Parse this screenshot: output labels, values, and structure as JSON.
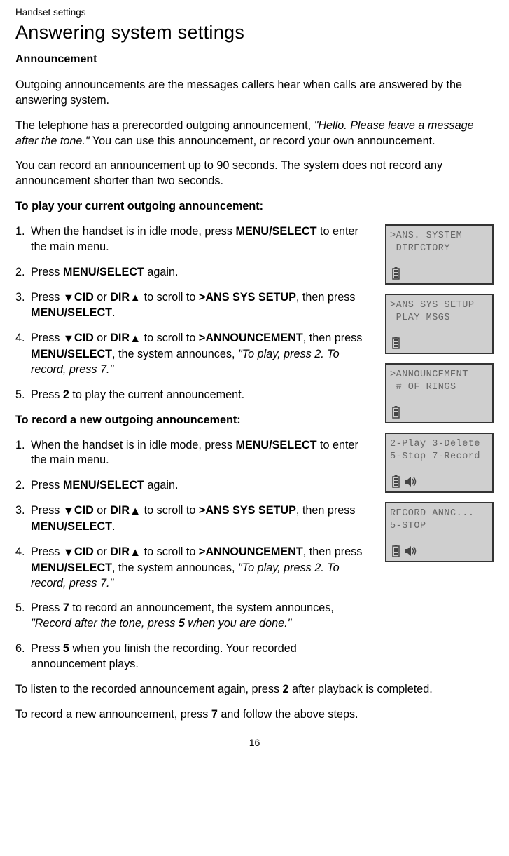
{
  "header": "Handset settings",
  "title": "Answering system settings",
  "subhead1": "Announcement",
  "intro1": "Outgoing announcements are the messages callers hear when calls are answered by the answering system.",
  "intro2a": "The telephone has a prerecorded outgoing announcement, ",
  "intro2b": "\"Hello. Please leave a message after the tone.\"",
  "intro2c": " You can use this announcement, or record your own announcement.",
  "intro3": "You can record an announcement up to 90 seconds. The system does not record any announcement shorter than two seconds.",
  "play_heading": "To play your current outgoing announcement:",
  "record_heading": "To record a new outgoing announcement:",
  "keys": {
    "menu_select_a": "MENU/",
    "menu_select_b": "SELECT",
    "menu_select_sc_a": "MENU",
    "menu_select_sc_b": "/SELECT",
    "cid": "CID",
    "dir": "DIR",
    "two": "2",
    "seven": "7",
    "five": "5"
  },
  "targets": {
    "ans_sys_setup": ">ANS SYS SETUP",
    "announcement": ">ANNOUNCEMENT"
  },
  "phrases": {
    "to_enter": " to enter the main menu.",
    "again": " again.",
    "scroll_to": " to scroll to ",
    "then_press": ", then press ",
    "period": ".",
    "sys_ann_a": ", the system announces, ",
    "sys_ann_b": "\"To play, press 2. To record, press 7.\"",
    "play_current": " to play the current announcement.",
    "rec_ann_a": " to record an announcement, the system announces, ",
    "rec_ann_b": "\"Record after the tone, press ",
    "rec_ann_c": " when you are done.\"",
    "finish": " when you finish the recording. Your recorded announcement plays.",
    "idle_press": "When the handset is in idle mode, press ",
    "press": "Press "
  },
  "outro1a": "To listen to the recorded announcement again, press ",
  "outro1b": " after playback is completed.",
  "outro2a": "To record a new announcement, press ",
  "outro2b": " and follow the above steps.",
  "lcd": {
    "1": {
      "l1": ">ANS. SYSTEM",
      "l2": " DIRECTORY"
    },
    "2": {
      "l1": ">ANS SYS SETUP",
      "l2": " PLAY MSGS"
    },
    "3": {
      "l1": ">ANNOUNCEMENT",
      "l2": " # OF RINGS"
    },
    "4": {
      "l1": "2-Play 3-Delete",
      "l2": "5-Stop 7-Record"
    },
    "5": {
      "l1": "RECORD ANNC...",
      "l2": "5-STOP"
    }
  },
  "page_number": "16"
}
